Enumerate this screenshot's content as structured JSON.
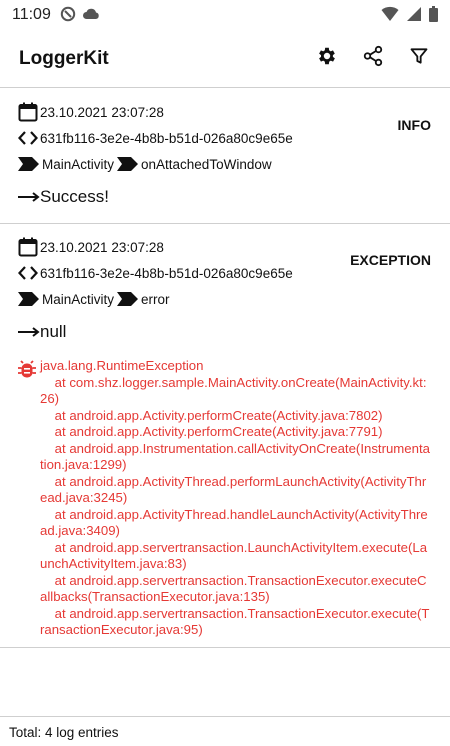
{
  "status_bar": {
    "time": "11:09",
    "left_icons": [
      "vpn-icon",
      "cloud-icon"
    ],
    "right_icons": [
      "wifi-icon",
      "signal-icon",
      "battery-icon"
    ]
  },
  "app_bar": {
    "title": "LoggerKit",
    "actions": [
      "gear-icon",
      "share-icon",
      "filter-icon"
    ]
  },
  "entries": [
    {
      "date": "23.10.2021 23:07:28",
      "session": "631fb116-3e2e-4b8b-b51d-026a80c9e65e",
      "class": "MainActivity",
      "method": "onAttachedToWindow",
      "level": "INFO",
      "message": "Success!"
    },
    {
      "date": "23.10.2021 23:07:28",
      "session": "631fb116-3e2e-4b8b-b51d-026a80c9e65e",
      "class": "MainActivity",
      "method": "error",
      "level": "EXCEPTION",
      "message": "null",
      "stacktrace": "java.lang.RuntimeException\n    at com.shz.logger.sample.MainActivity.onCreate(MainActivity.kt:26)\n    at android.app.Activity.performCreate(Activity.java:7802)\n    at android.app.Activity.performCreate(Activity.java:7791)\n    at android.app.Instrumentation.callActivityOnCreate(Instrumentation.java:1299)\n    at android.app.ActivityThread.performLaunchActivity(ActivityThread.java:3245)\n    at android.app.ActivityThread.handleLaunchActivity(ActivityThread.java:3409)\n    at android.app.servertransaction.LaunchActivityItem.execute(LaunchActivityItem.java:83)\n    at android.app.servertransaction.TransactionExecutor.executeCallbacks(TransactionExecutor.java:135)\n    at android.app.servertransaction.TransactionExecutor.execute(TransactionExecutor.java:95)"
    }
  ],
  "footer": {
    "total": "Total: 4 log entries"
  },
  "colors": {
    "exception_text": "#e53935",
    "divider": "#cfcfcf"
  }
}
